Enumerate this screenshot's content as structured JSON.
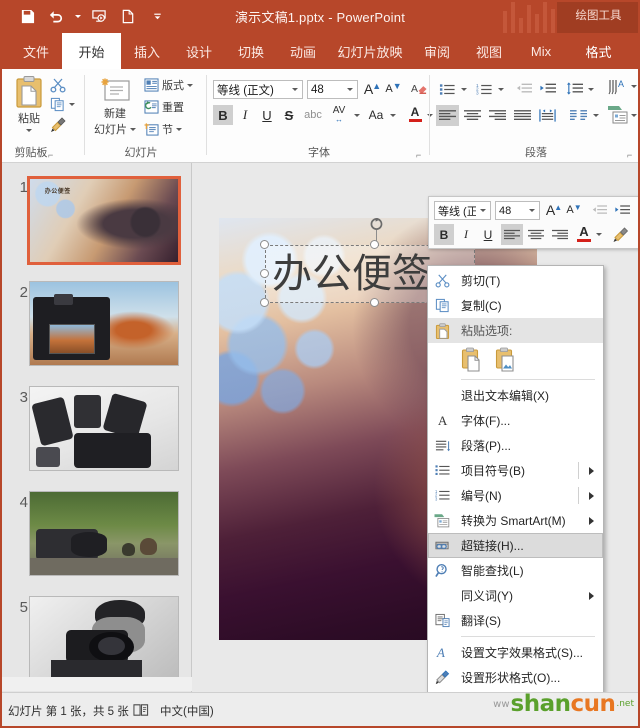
{
  "window": {
    "title": "演示文稿1.pptx - PowerPoint",
    "contextual_tab_group": "绘图工具"
  },
  "quick_access": [
    {
      "name": "save-icon",
      "label": "保存"
    },
    {
      "name": "undo-icon",
      "label": "撤消"
    },
    {
      "name": "start-slideshow-icon",
      "label": "从头开始"
    },
    {
      "name": "new-document-icon",
      "label": "新建"
    },
    {
      "name": "customize-qat-icon",
      "label": "自定义快速访问工具栏"
    }
  ],
  "tabs": [
    {
      "label": "文件",
      "active": false
    },
    {
      "label": "开始",
      "active": true
    },
    {
      "label": "插入",
      "active": false
    },
    {
      "label": "设计",
      "active": false
    },
    {
      "label": "切换",
      "active": false
    },
    {
      "label": "动画",
      "active": false
    },
    {
      "label": "幻灯片放映",
      "active": false
    },
    {
      "label": "审阅",
      "active": false
    },
    {
      "label": "视图",
      "active": false
    },
    {
      "label": "Mix",
      "active": false
    },
    {
      "label": "格式",
      "active": false
    }
  ],
  "ribbon": {
    "groups": [
      {
        "label": "剪贴板"
      },
      {
        "label": "幻灯片"
      },
      {
        "label": "字体"
      },
      {
        "label": "段落"
      }
    ],
    "clipboard": {
      "paste_label": "粘贴",
      "cut_icon": "scissors-icon",
      "copy_icon": "copy-icon",
      "format_painter_icon": "format-painter-icon"
    },
    "slides": {
      "new_slide_line1": "新建",
      "new_slide_line2": "幻灯片",
      "layout_label": "版式",
      "reset_label": "重置",
      "section_label": "节"
    },
    "font": {
      "font_name": "等线 (正文)",
      "font_size": "48",
      "bold": "B",
      "italic": "I",
      "underline": "U",
      "strikethrough": "S",
      "shadow": "abc",
      "spacing": "AV",
      "change_case": "Aa",
      "font_color": "A",
      "grow_font": "A",
      "shrink_font": "A",
      "clear_formatting_icon": "clear-formatting-icon"
    },
    "paragraph": {
      "bullets_icon": "bullets-icon",
      "numbering_icon": "numbering-icon",
      "decrease_indent_icon": "decrease-indent-icon",
      "increase_indent_icon": "increase-indent-icon",
      "line_spacing_icon": "line-spacing-icon",
      "text_direction_icon": "text-direction-icon",
      "align_text_icon": "align-text-icon",
      "align_left_icon": "align-left-icon",
      "align_center_icon": "align-center-icon",
      "align_right_icon": "align-right-icon",
      "justify_icon": "justify-icon",
      "columns_icon": "columns-icon",
      "convert_smartart_icon": "convert-to-smartart-icon"
    }
  },
  "mini_toolbar": {
    "font_name": "等线 (正文",
    "font_size": "48",
    "bold": "B",
    "italic": "I",
    "underline": "U",
    "font_color": "A",
    "grow_font": "A",
    "shrink_font": "A"
  },
  "thumbnails": [
    {
      "number": "1",
      "title": "办公便签",
      "selected": true
    },
    {
      "number": "2",
      "title": "",
      "selected": false
    },
    {
      "number": "3",
      "title": "",
      "selected": false
    },
    {
      "number": "4",
      "title": "",
      "selected": false
    },
    {
      "number": "5",
      "title": "",
      "selected": false
    }
  ],
  "slide": {
    "textbox_value": "办公便签"
  },
  "context_menu": {
    "items": [
      {
        "label": "剪切(T)",
        "icon": "scissors-icon",
        "type": "item",
        "highlight": false,
        "submenu": false
      },
      {
        "label": "复制(C)",
        "icon": "copy-icon",
        "type": "item",
        "highlight": false,
        "submenu": false
      },
      {
        "label": "粘贴选项:",
        "icon": "paste-icon",
        "type": "header",
        "highlight": false,
        "submenu": false
      },
      {
        "label": "退出文本编辑(X)",
        "icon": "",
        "type": "item",
        "highlight": false,
        "submenu": false
      },
      {
        "label": "字体(F)...",
        "icon": "font-icon",
        "type": "item",
        "highlight": false,
        "submenu": false
      },
      {
        "label": "段落(P)...",
        "icon": "paragraph-icon",
        "type": "item",
        "highlight": false,
        "submenu": false
      },
      {
        "label": "项目符号(B)",
        "icon": "bullets-icon",
        "type": "item",
        "highlight": false,
        "submenu": true
      },
      {
        "label": "编号(N)",
        "icon": "numbering-icon",
        "type": "item",
        "highlight": false,
        "submenu": true
      },
      {
        "label": "转换为 SmartArt(M)",
        "icon": "convert-to-smartart-icon",
        "type": "item",
        "highlight": false,
        "submenu": true
      },
      {
        "label": "超链接(H)...",
        "icon": "hyperlink-icon",
        "type": "item",
        "highlight": true,
        "submenu": false
      },
      {
        "label": "智能查找(L)",
        "icon": "smart-lookup-icon",
        "type": "item",
        "highlight": false,
        "submenu": false
      },
      {
        "label": "同义词(Y)",
        "icon": "",
        "type": "item",
        "highlight": false,
        "submenu": true
      },
      {
        "label": "翻译(S)",
        "icon": "translate-icon",
        "type": "item",
        "highlight": false,
        "submenu": false
      },
      {
        "label": "设置文字效果格式(S)...",
        "icon": "text-effects-icon",
        "type": "item",
        "highlight": false,
        "submenu": false
      },
      {
        "label": "设置形状格式(O)...",
        "icon": "format-shape-icon",
        "type": "item",
        "highlight": false,
        "submenu": false
      }
    ],
    "paste_options": [
      {
        "name": "paste-keep-source-formatting-icon"
      },
      {
        "name": "paste-picture-icon"
      }
    ]
  },
  "status_bar": {
    "slide_info": "幻灯片 第 1 张，共 5 张",
    "language": "中文(中国)",
    "notes_icon": "notes-icon"
  },
  "watermark": {
    "www": "ww",
    "shan": "shan",
    "cun": "cun",
    "net": ".net"
  },
  "colors": {
    "accent": "#b7472a",
    "contextual_tab": "#a03d22",
    "selection": "#e0603c",
    "ribbon_bg": "#fdfdfd",
    "pane_bg": "#e6e6e6"
  }
}
